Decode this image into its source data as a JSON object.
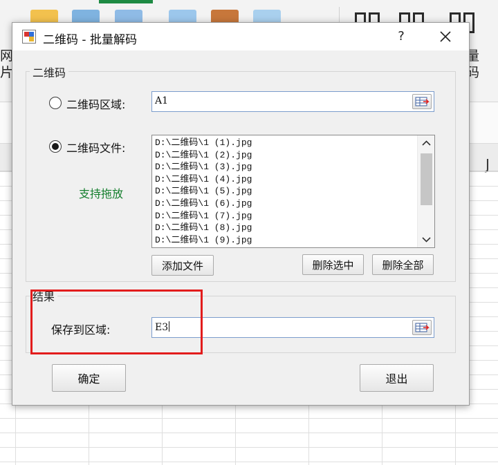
{
  "background": {
    "left_labels": [
      "网",
      "片"
    ],
    "right_labels": [
      "量",
      "码"
    ],
    "column_header": "J",
    "colors": {
      "ribbon": "#f3f3f3",
      "accent": "#1e8a43"
    }
  },
  "dialog": {
    "title": "二维码 - 批量解码",
    "help_label": "?",
    "qr_group": {
      "label": "二维码",
      "range_option": {
        "label": "二维码区域:",
        "checked": false
      },
      "range_value": "A1",
      "file_option": {
        "label": "二维码文件:",
        "checked": true
      },
      "drag_hint": "支持拖放",
      "files": [
        "D:\\二维码\\1 (1).jpg",
        "D:\\二维码\\1 (2).jpg",
        "D:\\二维码\\1 (3).jpg",
        "D:\\二维码\\1 (4).jpg",
        "D:\\二维码\\1 (5).jpg",
        "D:\\二维码\\1 (6).jpg",
        "D:\\二维码\\1 (7).jpg",
        "D:\\二维码\\1 (8).jpg",
        "D:\\二维码\\1 (9).jpg"
      ],
      "add_file_label": "添加文件",
      "delete_selected_label": "删除选中",
      "delete_all_label": "删除全部"
    },
    "result_group": {
      "label": "结果",
      "save_label": "保存到区域:",
      "save_value": "E3"
    },
    "ok_label": "确定",
    "exit_label": "退出",
    "highlight_color": "#e21c1c"
  }
}
